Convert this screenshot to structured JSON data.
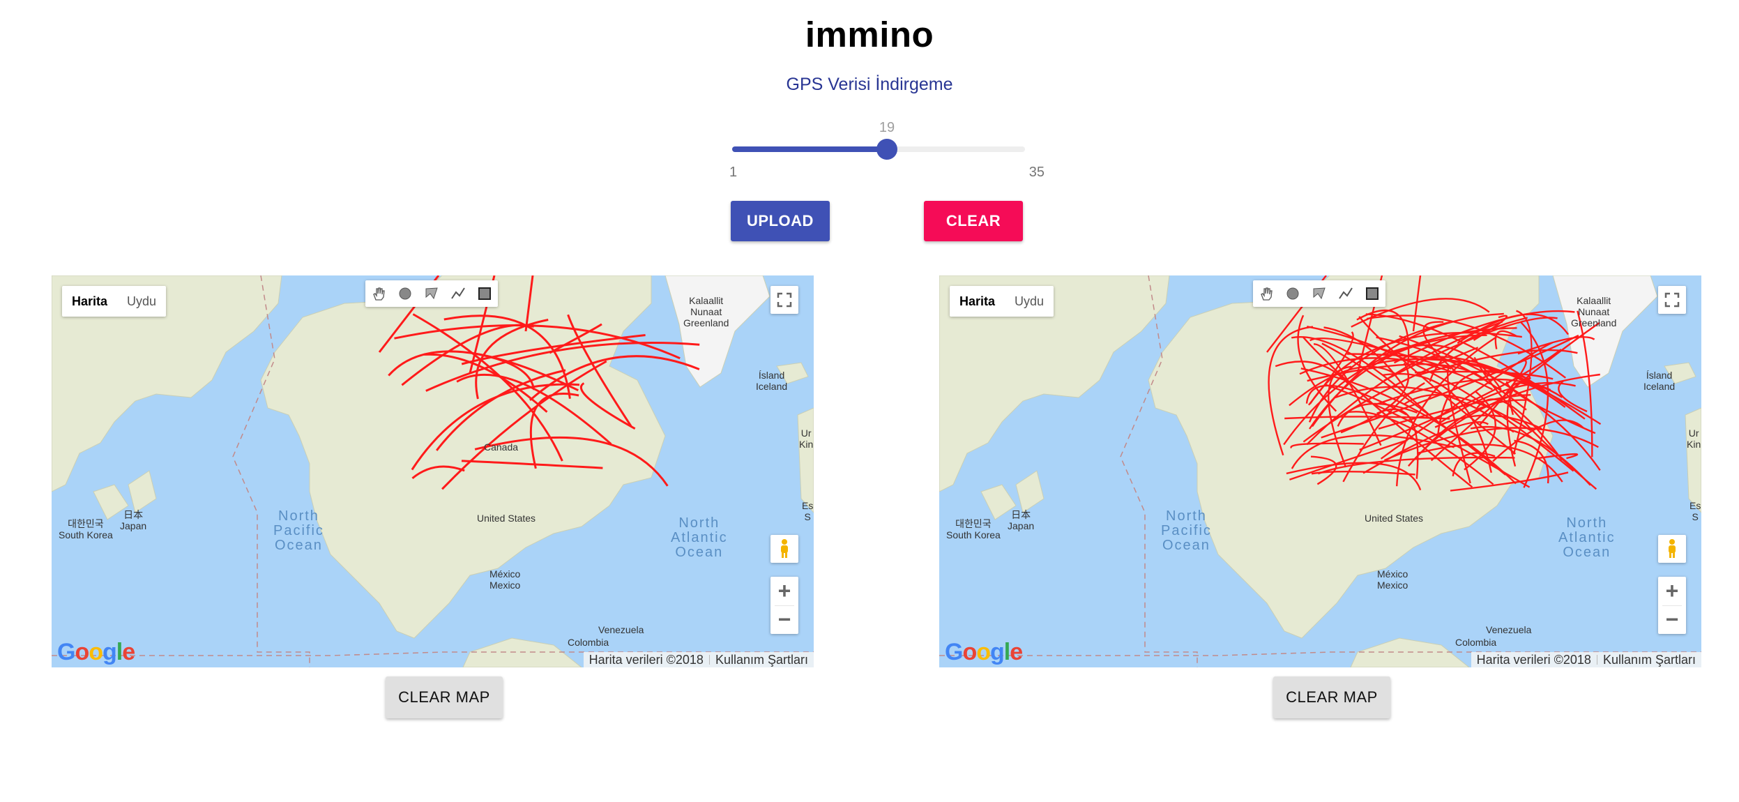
{
  "header": {
    "title": "immino",
    "subtitle": "GPS Verisi İndirgeme"
  },
  "slider": {
    "min": 1,
    "max": 35,
    "value": 19,
    "min_label": "1",
    "max_label": "35",
    "value_label": "19"
  },
  "buttons": {
    "upload": "UPLOAD",
    "clear": "CLEAR",
    "clear_map": "CLEAR MAP"
  },
  "map": {
    "type_buttons": [
      "Harita",
      "Uydu"
    ],
    "attribution": [
      "Harita verileri ©2018",
      "Kullanım Şartları"
    ],
    "logo": "Google",
    "labels": {
      "greenland": "Kalaallit\nNunaat\nGreenland",
      "iceland": "Ísland\nIceland",
      "canada": "Canada",
      "usa": "United States",
      "mexico": "México\nMexico",
      "venezuela": "Venezuela",
      "colombia": "Colombia",
      "korea": "대한민국\nSouth Korea",
      "japan": "日本\nJapan",
      "npo": "North\nPacific\nOcean",
      "nao": "North\nAtlantic\nOcean",
      "uk": "Ur\nKin",
      "es": "Es\nS"
    },
    "tool_icons": [
      "hand-icon",
      "circle-icon",
      "polygon-icon",
      "polyline-icon",
      "rectangle-icon"
    ]
  },
  "colors": {
    "route": "#ff1a1a",
    "primary": "#3f51b5",
    "accent": "#f50c57",
    "water": "#aad3f8",
    "land": "#e6ead3"
  }
}
